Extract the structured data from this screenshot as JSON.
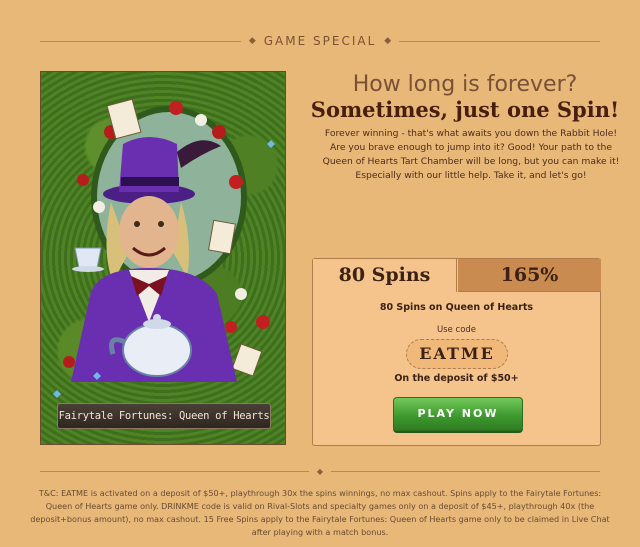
{
  "header": {
    "title": "GAME SPECIAL"
  },
  "art": {
    "caption": "Fairytale Fortunes: Queen of Hearts"
  },
  "hero": {
    "line1": "How long is forever?",
    "line2": "Sometimes, just one Spin!",
    "description": "Forever winning - that's what awaits you down the Rabbit Hole! Are you brave enough to jump into it? Good! Your path to the Queen of Hearts Tart Chamber will be long, but you can make it! Especially with our little help. Take it, and let's go!"
  },
  "offer": {
    "tabs": [
      {
        "label": "80 Spins",
        "active": true
      },
      {
        "label": "165%",
        "active": false
      }
    ],
    "title": "80 Spins on Queen of Hearts",
    "code_label": "Use code",
    "code": "EATME",
    "deposit": "On the deposit of $50+",
    "button": "PLAY NOW"
  },
  "terms": "T&C: EATME is activated on a deposit of $50+, playthrough 30x the spins winnings, no max cashout. Spins apply to the Fairytale Fortunes: Queen of Hearts game only. DRINKME code is valid on Rival-Slots and specialty games only on a deposit of $45+, playthrough 40x (the deposit+bonus amount), no max cashout. 15 Free Spins apply to the Fairytale Fortunes: Queen of Hearts game only to be claimed in Live Chat after playing with a match bonus.",
  "colors": {
    "background": "#e7b878",
    "accent_dark": "#4a1e0e",
    "button_green": "#3e9a2f",
    "hat_purple": "#6a2fb0"
  }
}
